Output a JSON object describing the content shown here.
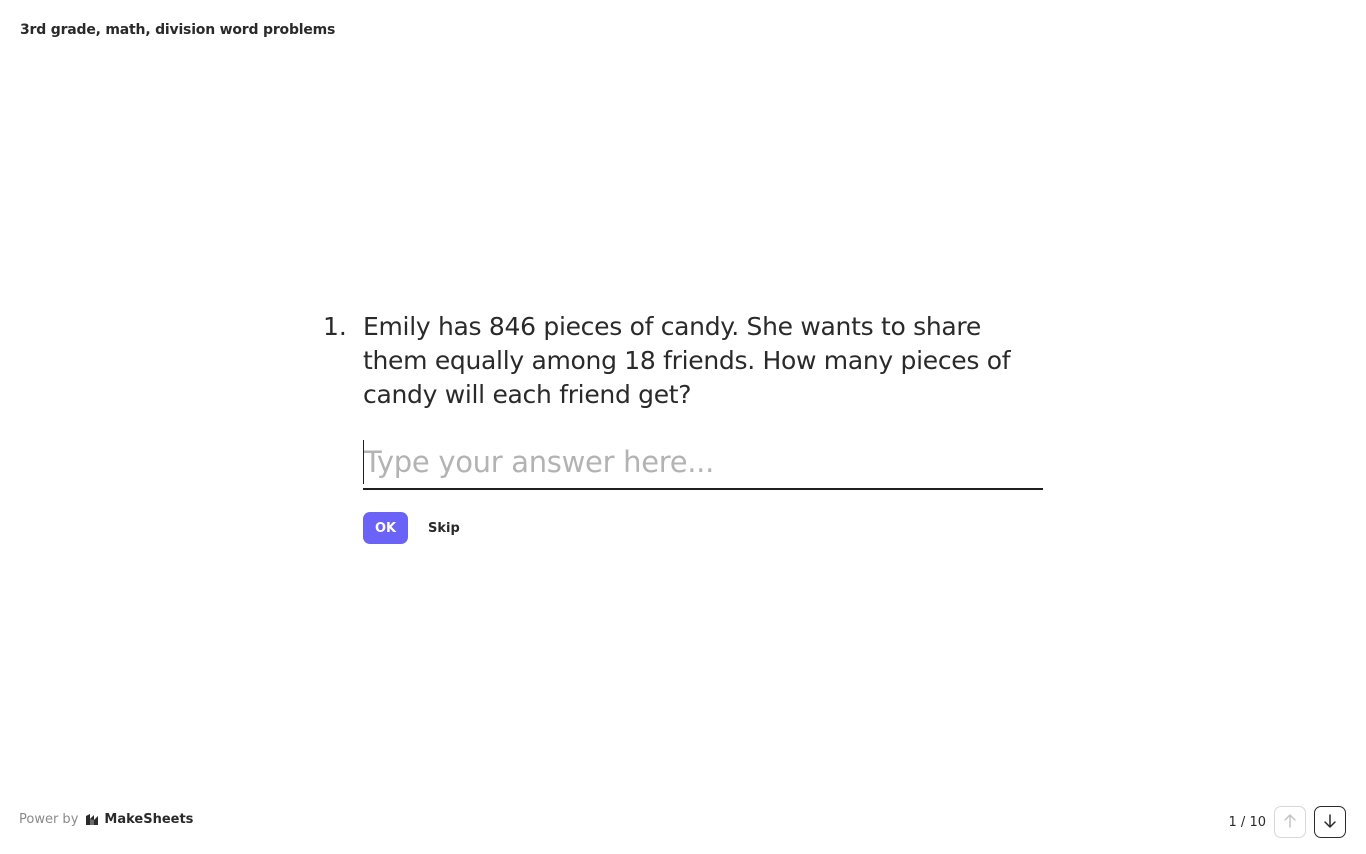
{
  "header": {
    "title": "3rd grade, math, division word problems"
  },
  "question": {
    "number": "1.",
    "text": "Emily has 846 pieces of candy. She wants to share them equally among 18 friends. How many pieces of candy will each friend get?",
    "answer_value": "",
    "answer_placeholder": "Type your answer here..."
  },
  "actions": {
    "ok_label": "OK",
    "skip_label": "Skip",
    "ok_color": "#6b63f7"
  },
  "footer": {
    "power_by": "Power by",
    "brand_name": "MakeSheets",
    "brand_icon": "makesheets-logo-icon",
    "pager_current": "1",
    "pager_separator": "/",
    "pager_total": "10",
    "pager_text": "1 / 10",
    "prev_icon": "arrow-up-icon",
    "next_icon": "arrow-down-icon"
  }
}
